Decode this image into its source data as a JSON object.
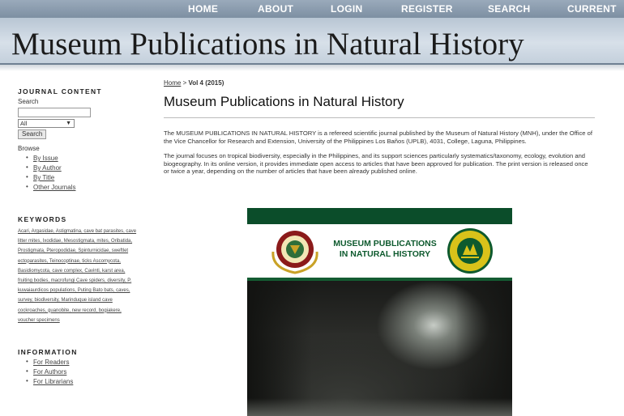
{
  "nav": [
    "HOME",
    "ABOUT",
    "LOGIN",
    "REGISTER",
    "SEARCH",
    "CURRENT"
  ],
  "site_title": "Museum Publications in Natural History",
  "sidebar": {
    "journal_content_title": "JOURNAL CONTENT",
    "search_label": "Search",
    "search_value": "",
    "select_value": "All",
    "search_button": "Search",
    "browse_label": "Browse",
    "browse_items": [
      "By Issue",
      "By Author",
      "By Title",
      "Other Journals"
    ],
    "keywords_title": "KEYWORDS",
    "keywords": "Acari, Argasidae, Astigmatina, cave bat parasites, cave litter mites, Ixodidae, Mesostigmata, mites, Oribatida, Prostigmata, Pteropodidae, Spinturnicidae, sweftlet ectoparasites, Teinocoptinae, ticks Ascomycota, Basidiomycota, cave complex, Cavinti, karst area, fruiting bodies, macrofungi Cave spiders, diversity, P. kuwaiaurdicos populations, Puting Bato bats, caves, survey, biodiversity, Marinduque island cave cockroaches, guanobite, new record, bogiakere, voucher specimens",
    "information_title": "INFORMATION",
    "information_items": [
      "For Readers",
      "For Authors",
      "For Librarians"
    ]
  },
  "breadcrumb": {
    "home": "Home",
    "sep": ">",
    "current": "Vol 4 (2015)"
  },
  "main": {
    "title": "Museum Publications in Natural History",
    "para1": "The MUSEUM PUBLICATIONS IN NATURAL HISTORY is a refereed scientific journal published by the Museum of Natural History (MNH), under the Office of the Vice Chancellor for Research and Extension, University of the Philippines Los Baños (UPLB), 4031, College, Laguna, Philippines.",
    "para2": "The journal focuses on tropical biodiversity, especially in the Philippines, and its support sciences particularly systematics/taxonomy, ecology, evolution and biogeography. In its online version, it provides immediate open access to articles that have been approved for publication. The print version is released once or twice a year, depending on the number of articles that have been already published online."
  },
  "cover": {
    "title_line1": "MUSEUM PUBLICATIONS",
    "title_line2": "IN NATURAL HISTORY"
  },
  "colors": {
    "nav_bg": "#8797a9",
    "cover_green": "#0b4d2a",
    "seal_red": "#8b1a1a",
    "seal_gold": "#d9c21a"
  }
}
